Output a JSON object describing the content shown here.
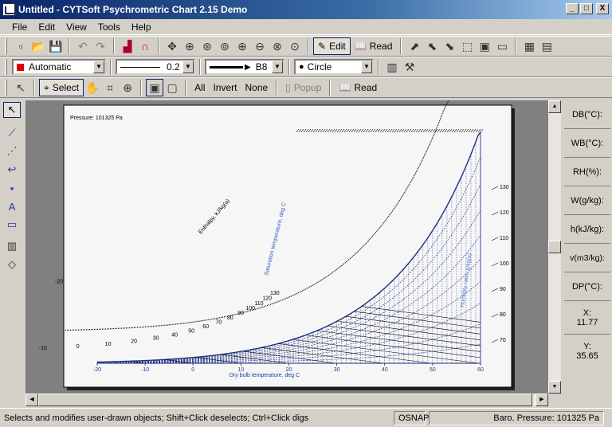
{
  "window": {
    "title": "Untitled - CYTSoft Psychrometric Chart 2.15 Demo",
    "minimize": "_",
    "maximize": "□",
    "close": "X"
  },
  "menu": [
    "File",
    "Edit",
    "View",
    "Tools",
    "Help"
  ],
  "toolbar1": {
    "edit_label": "Edit",
    "read_label": "Read"
  },
  "toolbar2": {
    "color_label": "Automatic",
    "color_value": "#e00000",
    "width_value": "0.2",
    "arrow_value": "B8",
    "marker_value": "Circle"
  },
  "toolbar3": {
    "select_label": "Select",
    "all_label": "All",
    "invert_label": "Invert",
    "none_label": "None",
    "popup_label": "Popup",
    "read_label": "Read"
  },
  "chart_data": {
    "type": "psychrometric",
    "pressure_label": "Pressure: 101325 Pa",
    "xlabel": "Dry bulb temperature, deg C",
    "x_ticks": [
      "-20",
      "-10",
      "0",
      "10",
      "20",
      "30",
      "40",
      "50",
      "60"
    ],
    "enthalpy_label": "Enthalpy, kJ/kg(a)",
    "enthalpy_ticks": [
      "-20",
      "-10",
      "0",
      "10",
      "20",
      "30",
      "40",
      "50",
      "60",
      "70",
      "80",
      "90",
      "100",
      "110",
      "120",
      "130"
    ],
    "saturation_label": "Saturation temperature, deg C",
    "humidity_label": "Humidity ratio, g/kg(a)",
    "humidity_ticks": [
      "70",
      "80",
      "90",
      "100",
      "110",
      "120",
      "130"
    ],
    "x_range": [
      -20,
      60
    ],
    "enthalpy_range": [
      -20,
      130
    ]
  },
  "readouts": {
    "db": "DB(°C):",
    "wb": "WB(°C):",
    "rh": "RH(%):",
    "w": "W(g/kg):",
    "h": "h(kJ/kg):",
    "v": "v(m3/kg):",
    "dp": "DP(°C):",
    "x_label": "X:",
    "x_value": "11.77",
    "y_label": "Y:",
    "y_value": "35.65"
  },
  "status": {
    "message": "Selects and modifies user-drawn objects; Shift+Click deselects; Ctrl+Click digs",
    "osnap": "OSNAP",
    "pressure": "Baro. Pressure: 101325 Pa"
  }
}
